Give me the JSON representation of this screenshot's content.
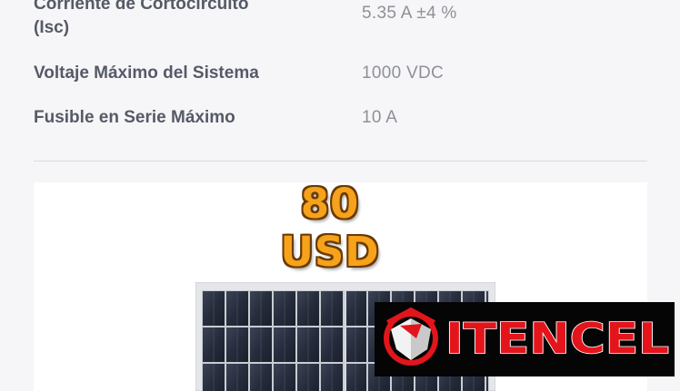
{
  "specs": [
    {
      "label_line1": "Corriente de Cortocircuito",
      "label_line2": "(Isc)",
      "value": "5.35 A ±4 %"
    },
    {
      "label": "Voltaje Máximo del Sistema",
      "value": "1000 VDC"
    },
    {
      "label": "Fusible en Serie Máximo",
      "value": "10 A"
    }
  ],
  "product": {
    "price": "80 USD",
    "price_color": "#f6a21a"
  },
  "brand": {
    "name": "ITENCEL",
    "name_color": "#e3151b",
    "background": "#050505",
    "icon": "shield-emblem-icon"
  },
  "colors": {
    "label": "#555a66",
    "value": "#8e9099",
    "page_background": "#f6f6f8"
  }
}
